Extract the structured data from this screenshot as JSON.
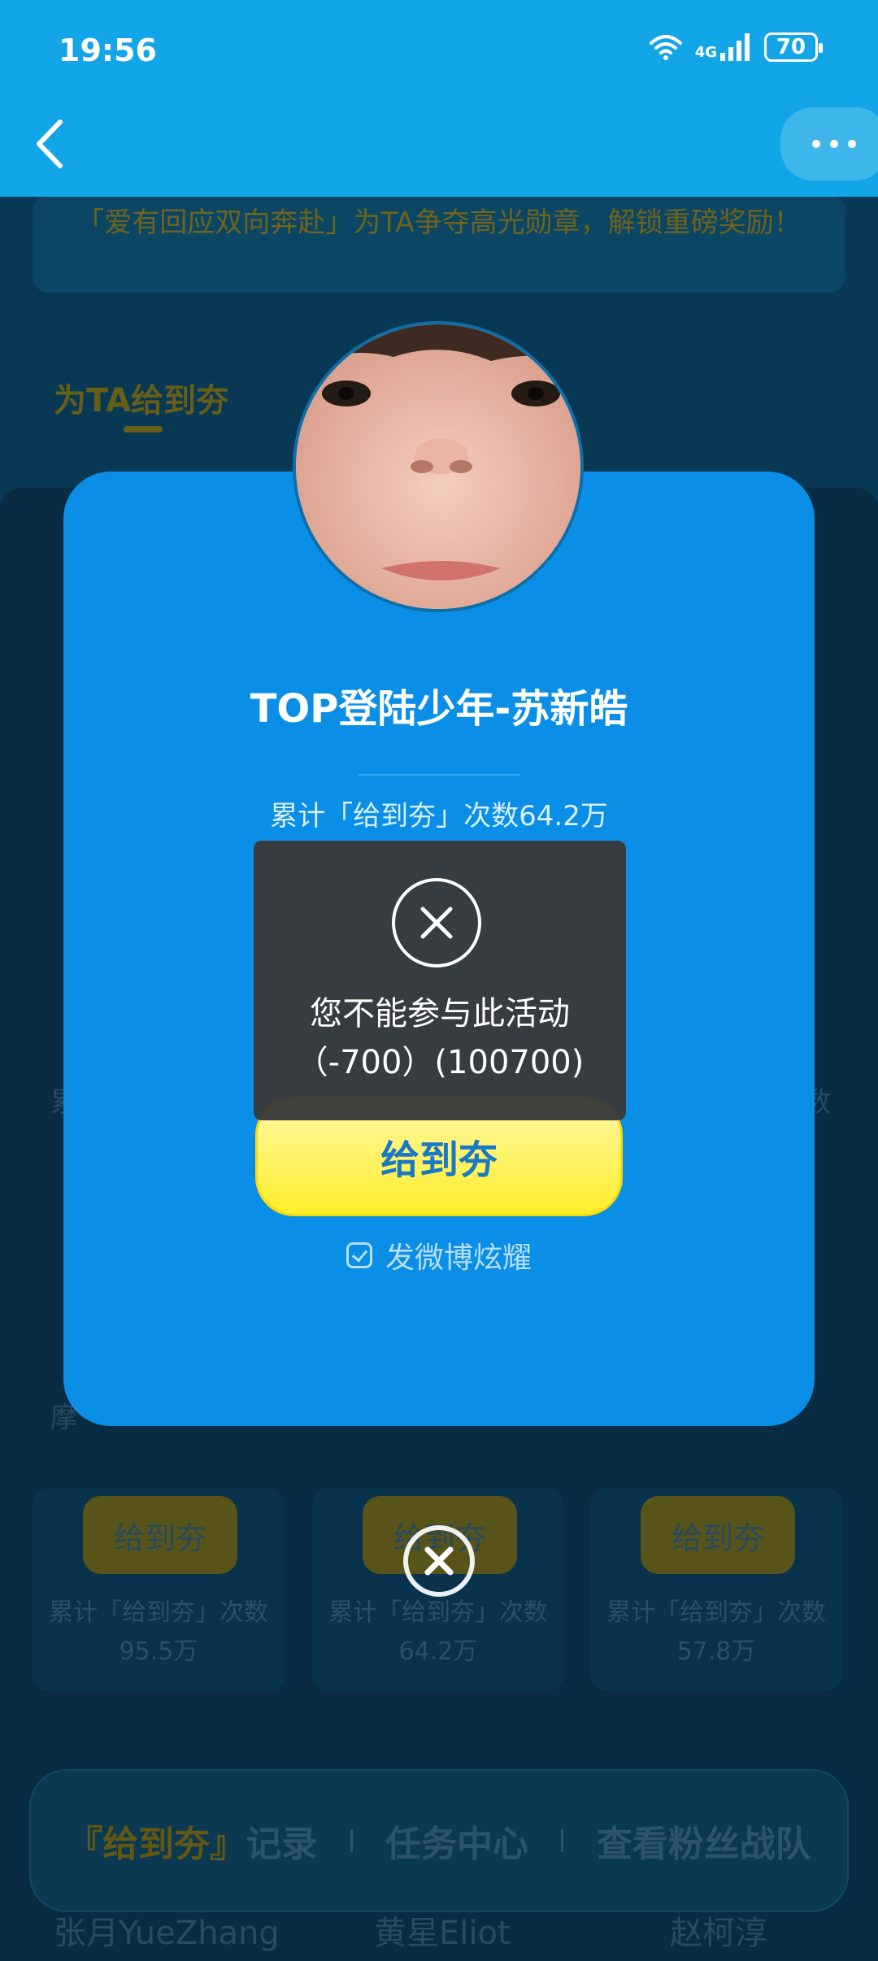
{
  "status_bar": {
    "time": "19:56",
    "network": "4G",
    "battery": "70"
  },
  "background": {
    "banner_text": "「爱有回应双向奔赴」为TA争夺高光勋章，解锁重磅奖励！",
    "section_title": "为TA给到夯",
    "partial_left_text": "摩",
    "partial_left_text2": "累",
    "partial_right_text": "数",
    "cards": [
      {
        "button": "给到夯",
        "stat_line1": "累计「给到夯」次数",
        "stat_line2": "95.5万"
      },
      {
        "button": "给到夯",
        "stat_line1": "累计「给到夯」次数",
        "stat_line2": "64.2万"
      },
      {
        "button": "给到夯",
        "stat_line1": "累计「给到夯」次数",
        "stat_line2": "57.8万"
      }
    ],
    "names": [
      "张月YueZhang",
      "黄星Eliot",
      "赵柯淳"
    ],
    "bottom_nav": {
      "record_highlight": "『给到夯』",
      "record_suffix": "记录",
      "tasks": "任务中心",
      "fans": "查看粉丝战队"
    }
  },
  "modal": {
    "title": "TOP登陆少年-苏新皓",
    "count_text": "累计「给到夯」次数64.2万",
    "stepper_minus": "−",
    "stepper_plus": "+",
    "give_button": "给到夯",
    "share_label": "发微博炫耀"
  },
  "toast": {
    "line1": "您不能参与此活动",
    "line2": "（-700）(100700)"
  }
}
